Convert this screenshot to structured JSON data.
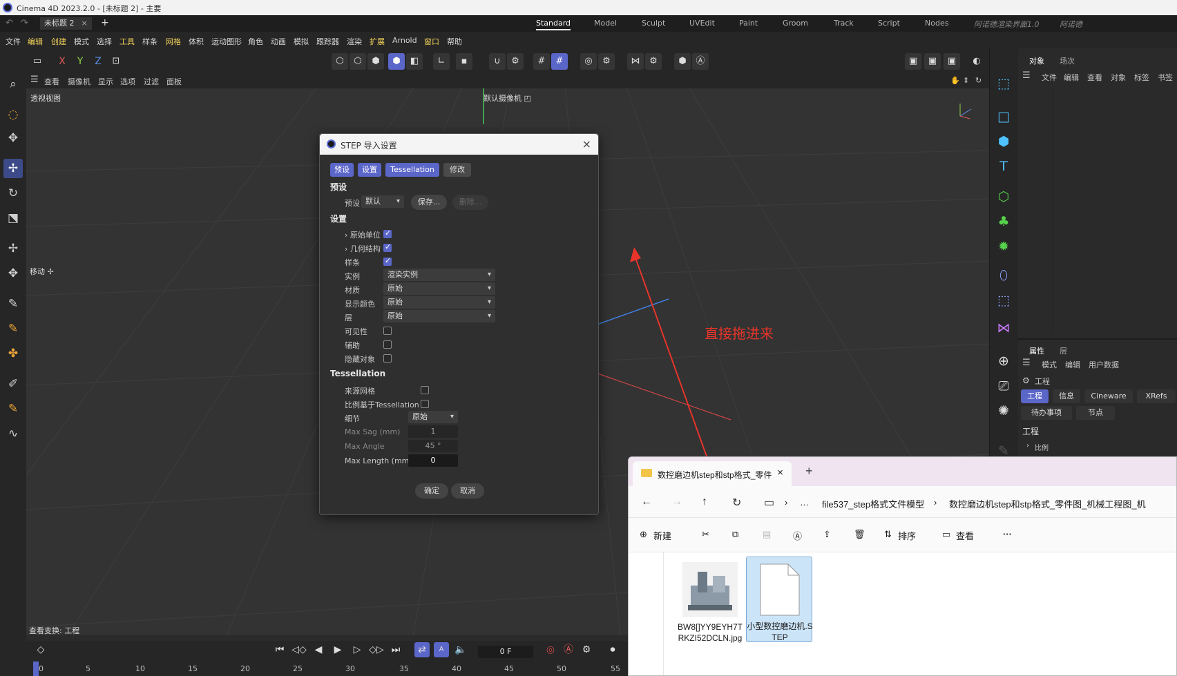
{
  "window": {
    "title": "Cinema 4D 2023.2.0 - [未标题 2] - 主要"
  },
  "doc_tab": {
    "label": "未标题 2",
    "close": "×",
    "add": "+"
  },
  "layouts": [
    "Standard",
    "Model",
    "Sculpt",
    "UVEdit",
    "Paint",
    "Groom",
    "Track",
    "Script",
    "Nodes",
    "阿诺德渲染界面1.0",
    "阿诺德"
  ],
  "menu": [
    "文件",
    "编辑",
    "创建",
    "模式",
    "选择",
    "工具",
    "样条",
    "网格",
    "体积",
    "运动图形",
    "角色",
    "动画",
    "模拟",
    "跟踪器",
    "渲染",
    "扩展",
    "Arnold",
    "窗口",
    "帮助"
  ],
  "toolbar": {
    "x": "X",
    "y": "Y",
    "z": "Z"
  },
  "viewport": {
    "menu": [
      "查看",
      "摄像机",
      "显示",
      "选项",
      "过滤",
      "面板"
    ],
    "label": "透视视图",
    "camera": "默认摄像机 ◰",
    "move_label": "移动 ✢",
    "status": "查看变换: 工程",
    "annotation": "直接拖进来"
  },
  "timeline": {
    "frame": "0 F",
    "ticks": [
      "0",
      "5",
      "10",
      "15",
      "20",
      "25",
      "30",
      "35",
      "40",
      "45",
      "50",
      "55"
    ]
  },
  "object_panel": {
    "tabs": [
      "对象",
      "场次"
    ],
    "menu": [
      "文件",
      "编辑",
      "查看",
      "对象",
      "标签",
      "书签"
    ]
  },
  "attr_panel": {
    "tabs": [
      "属性",
      "层"
    ],
    "menu": [
      "模式",
      "编辑",
      "用户数据"
    ],
    "project": "工程",
    "chips": [
      "工程",
      "信息",
      "Cineware",
      "XRefs",
      "待办事项",
      "节点"
    ],
    "section": "工程",
    "row": "比例"
  },
  "dialog": {
    "title": "STEP 导入设置",
    "close": "×",
    "tabs": [
      "预设",
      "设置",
      "Tessellation",
      "修改"
    ],
    "preset_section": "预设",
    "preset_label": "预设",
    "preset_value": "默认",
    "save_label": "保存...",
    "delete_label": "删除...",
    "settings_section": "设置",
    "rows": [
      {
        "label": "› 原始单位",
        "checked": true
      },
      {
        "label": "› 几何结构",
        "checked": true
      },
      {
        "label": "样条",
        "checked": true
      }
    ],
    "dropdown_rows": [
      {
        "label": "实例",
        "value": "渲染实例"
      },
      {
        "label": "材质",
        "value": "原始"
      },
      {
        "label": "显示颜色",
        "value": "原始"
      },
      {
        "label": "层",
        "value": "原始"
      }
    ],
    "check_rows": [
      {
        "label": "可见性",
        "checked": false
      },
      {
        "label": "辅助",
        "checked": false
      },
      {
        "label": "隐藏对象",
        "checked": false
      }
    ],
    "tess_section": "Tessellation",
    "source_mesh": "来源网格",
    "ratio_tess": "比例基于Tessellation",
    "detail_label": "细节",
    "detail_value": "原始",
    "max_sag_label": "Max Sag (mm)",
    "max_sag_value": "1",
    "max_angle_label": "Max Angle",
    "max_angle_value": "45 °",
    "max_length_label": "Max Length (mm)",
    "max_length_value": "0",
    "ok": "确定",
    "cancel": "取消"
  },
  "explorer": {
    "tab_title": "数控磨边机step和stp格式_零件",
    "tab_close": "×",
    "add": "+",
    "crumbs": [
      "…",
      "file537_step格式文件模型",
      "数控磨边机step和stp格式_零件图_机械工程图_机"
    ],
    "cmd": {
      "new": "新建",
      "sort": "排序",
      "view": "查看",
      "more": "···"
    },
    "files": [
      {
        "name": "BW8[]YY9EYH7TRKZI52DCLN.jpg",
        "selected": false
      },
      {
        "name": "小型数控磨边机.STEP",
        "selected": true
      }
    ]
  },
  "colors": {
    "accent": "#5b66c9",
    "annotation": "#e8342a"
  }
}
